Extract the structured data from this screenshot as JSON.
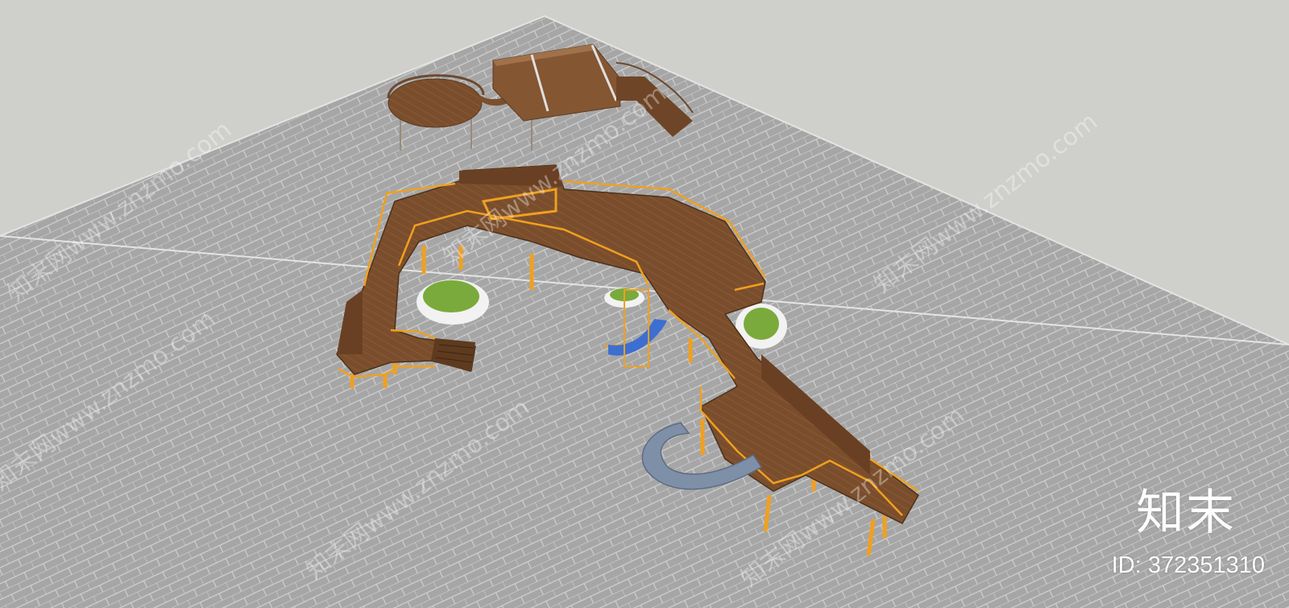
{
  "watermark": {
    "brand": "知末",
    "id_label": "ID: 372351310",
    "repeated_text": "知末网www.znzmo.com"
  },
  "colors": {
    "sky": "#cfd0cc",
    "ground": "#a8a8a8",
    "grid": "#d2d2d2",
    "deck": "#7b4f2c",
    "railing": "#f0a020",
    "grass": "#7aaa3c",
    "slide_blue": "#3d6fd0",
    "tube_slide": "#7e8fa8"
  }
}
